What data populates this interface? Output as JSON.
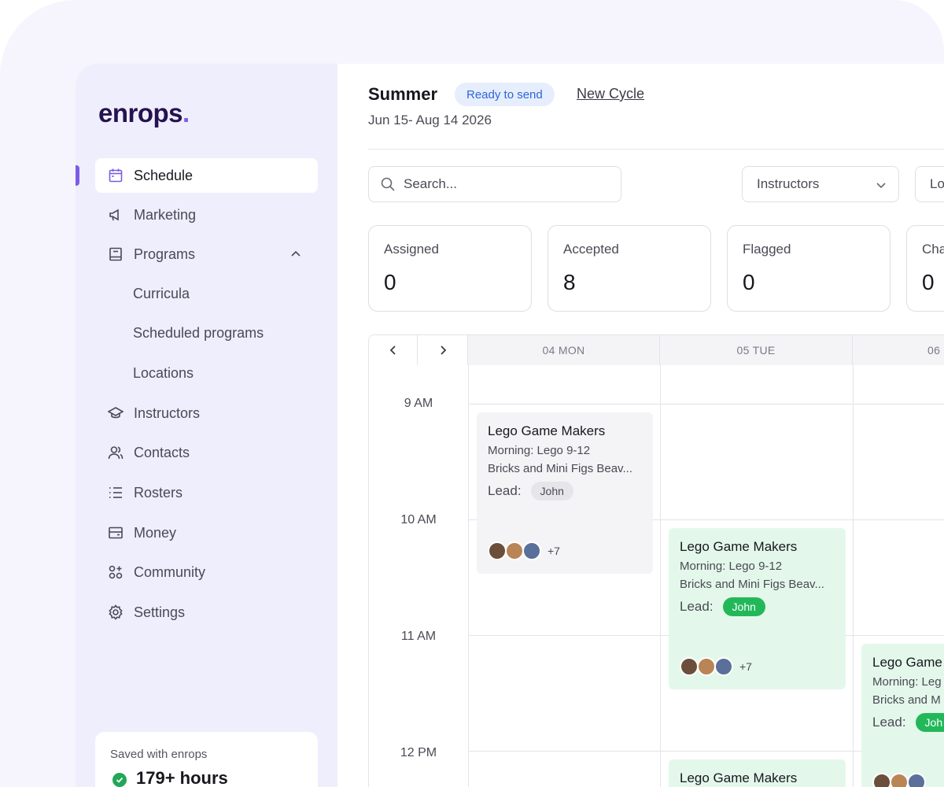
{
  "brand": {
    "name": "enrops",
    "dot": "."
  },
  "sidebar": {
    "items": [
      {
        "label": "Schedule"
      },
      {
        "label": "Marketing"
      },
      {
        "label": "Programs"
      },
      {
        "label": "Curricula"
      },
      {
        "label": "Scheduled programs"
      },
      {
        "label": "Locations"
      },
      {
        "label": "Instructors"
      },
      {
        "label": "Contacts"
      },
      {
        "label": "Rosters"
      },
      {
        "label": "Money"
      },
      {
        "label": "Community"
      },
      {
        "label": "Settings"
      }
    ],
    "saved": {
      "caption": "Saved with enrops",
      "value": "179+ hours"
    }
  },
  "header": {
    "title": "Summer",
    "status": "Ready to send",
    "new_cycle": "New Cycle",
    "dates": "Jun 15- Aug 14 2026"
  },
  "filters": {
    "search_placeholder": "Search...",
    "instructors": "Instructors",
    "locations_partial": "Lo"
  },
  "stats": [
    {
      "label": "Assigned",
      "value": "0"
    },
    {
      "label": "Accepted",
      "value": "8"
    },
    {
      "label": "Flagged",
      "value": "0"
    },
    {
      "label": "Cha",
      "value": "0"
    }
  ],
  "calendar": {
    "days": [
      "04 MON",
      "05 TUE",
      "06"
    ],
    "times": [
      "9 AM",
      "10 AM",
      "11 AM",
      "12 PM"
    ],
    "events": [
      {
        "title": "Lego Game Makers",
        "line1": "Morning: Lego 9-12",
        "line2": "Bricks and Mini Figs Beav...",
        "lead_label": "Lead:",
        "lead": "John",
        "more": "+7"
      },
      {
        "title": "Lego Game Makers",
        "line1": "Morning: Lego 9-12",
        "line2": "Bricks and Mini Figs Beav...",
        "lead_label": "Lead:",
        "lead": "John",
        "more": "+7"
      },
      {
        "title": "Lego Game",
        "line1": "Morning: Leg",
        "line2": "Bricks and M",
        "lead_label": "Lead:",
        "lead": "Joh"
      },
      {
        "title": "Lego Game Makers"
      }
    ]
  },
  "colors": {
    "accent": "#7a5ce6",
    "green": "#22b85a",
    "status_blue": "#2f64d8"
  }
}
